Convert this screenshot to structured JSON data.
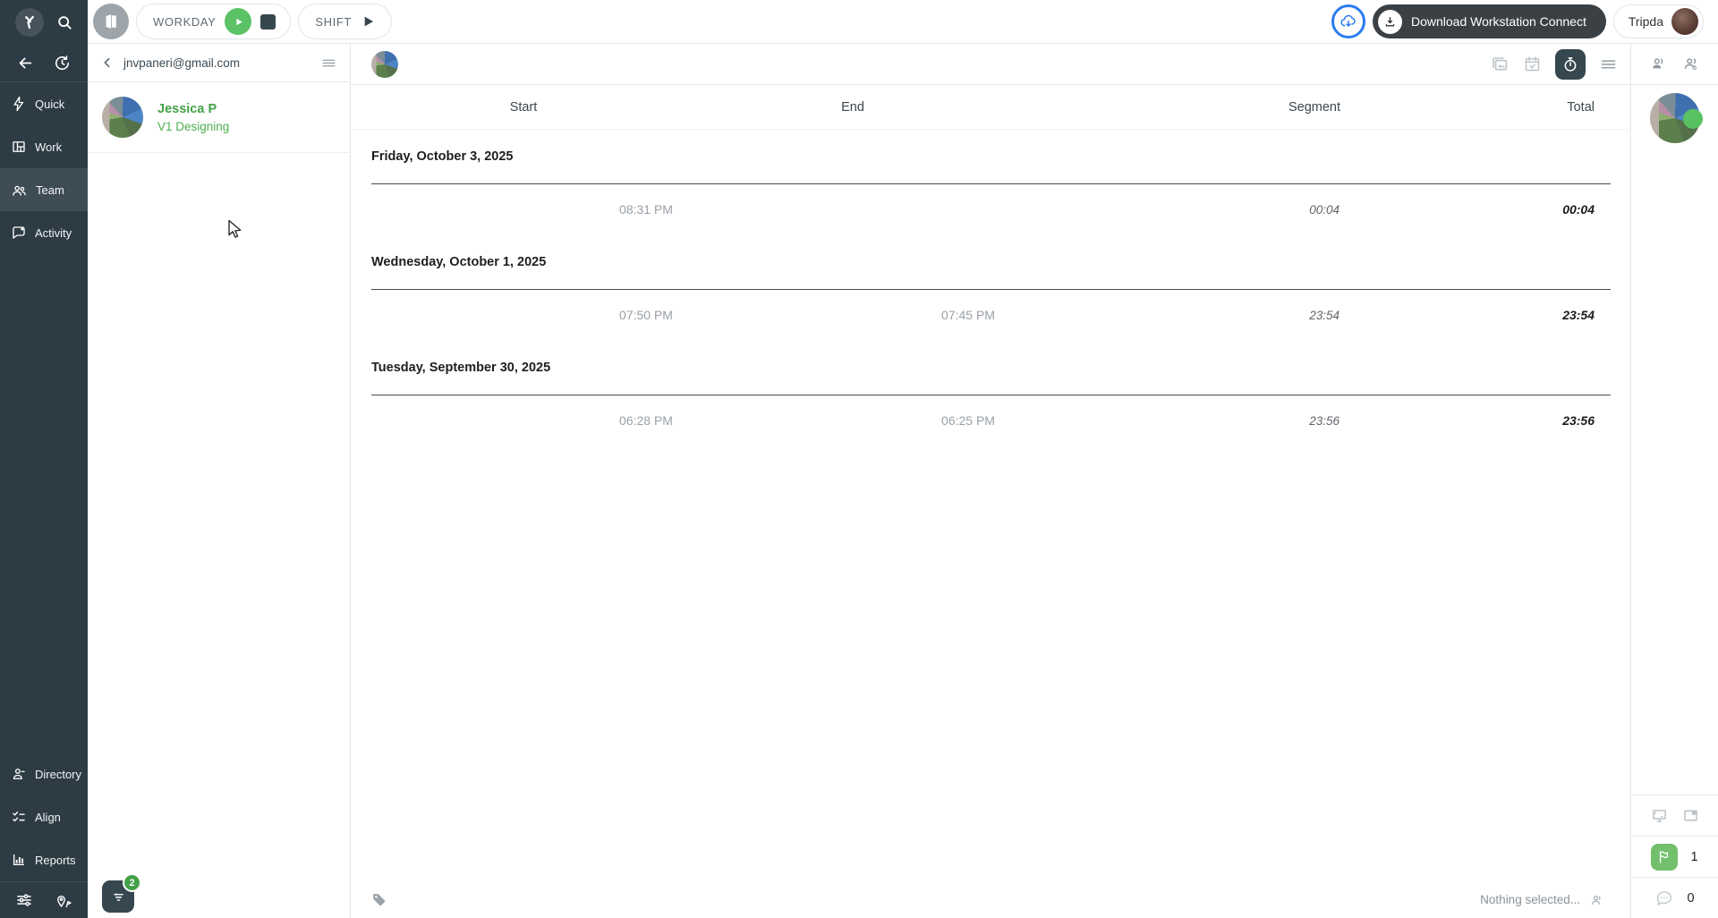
{
  "topbar": {
    "workday_label": "WORKDAY",
    "shift_label": "SHIFT",
    "download_label": "Download Workstation Connect",
    "account_label": "Tripda"
  },
  "sidebar": {
    "top": [
      {
        "label": "Quick",
        "icon": "lightning-icon"
      },
      {
        "label": "Work",
        "icon": "grid-icon"
      },
      {
        "label": "Team",
        "icon": "team-icon",
        "active": true
      },
      {
        "label": "Activity",
        "icon": "chat-bubble-icon"
      }
    ],
    "bottom": [
      {
        "label": "Directory",
        "icon": "person-icon"
      },
      {
        "label": "Align",
        "icon": "checklist-icon"
      },
      {
        "label": "Reports",
        "icon": "bar-chart-icon"
      }
    ]
  },
  "userpanel": {
    "header_email": "jnvpaneri@gmail.com",
    "user_name": "Jessica P",
    "user_task": "V1 Designing",
    "filter_badge": "2"
  },
  "timesheet": {
    "columns": [
      "Start",
      "End",
      "Segment",
      "Total"
    ],
    "sections": [
      {
        "date": "Friday, October 3, 2025",
        "rows": [
          {
            "start": "08:31 PM",
            "end": "",
            "segment": "00:04",
            "total": "00:04"
          }
        ]
      },
      {
        "date": "Wednesday, October 1, 2025",
        "rows": [
          {
            "start": "07:50 PM",
            "end": "07:45 PM",
            "segment": "23:54",
            "total": "23:54"
          }
        ]
      },
      {
        "date": "Tuesday, September 30, 2025",
        "rows": [
          {
            "start": "06:28 PM",
            "end": "06:25 PM",
            "segment": "23:56",
            "total": "23:56"
          }
        ]
      }
    ]
  },
  "statusbar": {
    "selection": "Nothing selected..."
  },
  "rightpanel": {
    "flag_count": "1",
    "chat_count": "0"
  },
  "colors": {
    "sidebar_bg": "#2d3b44",
    "accent_green": "#43a047",
    "dark_slate": "#37474f",
    "accent_blue": "#2a7cf0"
  }
}
